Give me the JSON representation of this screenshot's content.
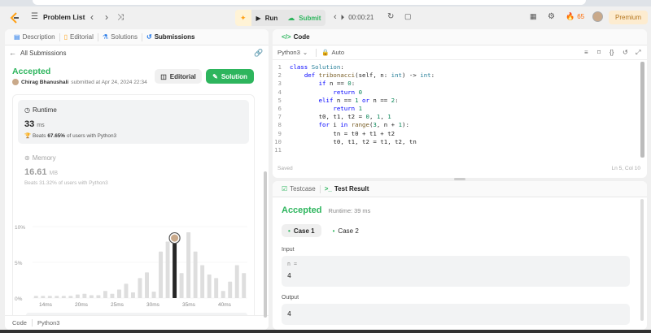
{
  "header": {
    "problem_list": "Problem List",
    "run": "Run",
    "submit": "Submit",
    "timer": "00:00:21",
    "streak": "65",
    "premium": "Premium"
  },
  "left": {
    "tabs": [
      "Description",
      "Editorial",
      "Solutions",
      "Submissions"
    ],
    "back": "All Submissions",
    "status": "Accepted",
    "user": "Chirag Bhanushali",
    "submitted": "submitted at Apr 24, 2024 22:34",
    "editorial_btn": "Editorial",
    "solution_btn": "Solution",
    "runtime": {
      "label": "Runtime",
      "value": "33",
      "unit": "ms",
      "beats_prefix": "Beats",
      "beats_pct": "67.65%",
      "beats_suffix": "of users with Python3"
    },
    "memory": {
      "label": "Memory",
      "value": "16.61",
      "unit": "MB",
      "beats": "Beats 31.32% of users with Python3"
    },
    "footer_code": "Code",
    "footer_lang": "Python3"
  },
  "chart_data": {
    "type": "bar",
    "yticks": [
      "10%",
      "5%",
      "0%"
    ],
    "ylim": [
      0,
      10
    ],
    "xticks": [
      "14ms",
      "20ms",
      "25ms",
      "30ms",
      "35ms",
      "40ms"
    ],
    "mini_xticks": [
      "14ms",
      "20ms",
      "25ms",
      "30ms",
      "35ms",
      "40ms"
    ],
    "values": [
      0.3,
      0.3,
      0.3,
      0.3,
      0.3,
      0.3,
      0.5,
      0.6,
      0.4,
      0.4,
      1.0,
      0.6,
      1.2,
      2.0,
      0.8,
      2.8,
      3.6,
      0.9,
      6.5,
      7.9,
      8.4,
      3.5,
      9.2,
      6.5,
      4.6,
      3.3,
      2.8,
      1.0,
      2.3,
      4.6,
      3.5
    ],
    "highlight_index": 20,
    "colors": {
      "bar": "#dedede",
      "highlight": "#262626"
    }
  },
  "code": {
    "title": "Code",
    "language": "Python3",
    "auto": "Auto",
    "lines": [
      {
        "n": "1",
        "t": "class Solution:"
      },
      {
        "n": "2",
        "t": "    def tribonacci(self, n: int) -> int:"
      },
      {
        "n": "3",
        "t": "        if n == 0:"
      },
      {
        "n": "4",
        "t": "            return 0"
      },
      {
        "n": "5",
        "t": "        elif n == 1 or n == 2:"
      },
      {
        "n": "6",
        "t": "            return 1"
      },
      {
        "n": "7",
        "t": "        t0, t1, t2 = 0, 1, 1"
      },
      {
        "n": "8",
        "t": "        for i in range(3, n + 1):"
      },
      {
        "n": "9",
        "t": "            tn = t0 + t1 + t2"
      },
      {
        "n": "10",
        "t": "            t0, t1, t2 = t1, t2, tn"
      },
      {
        "n": "11",
        "t": ""
      }
    ],
    "saved": "Saved",
    "cursor": "Ln 5, Col 10"
  },
  "result": {
    "tab_testcase": "Testcase",
    "tab_result": "Test Result",
    "status": "Accepted",
    "runtime": "Runtime: 39 ms",
    "cases": [
      "Case 1",
      "Case 2"
    ],
    "input_label": "Input",
    "input_var": "n =",
    "input_val": "4",
    "output_label": "Output",
    "output_val": "4"
  },
  "colors": {
    "accent_green": "#2db55d",
    "orange": "#ffa116",
    "premium": "#b4761e"
  }
}
